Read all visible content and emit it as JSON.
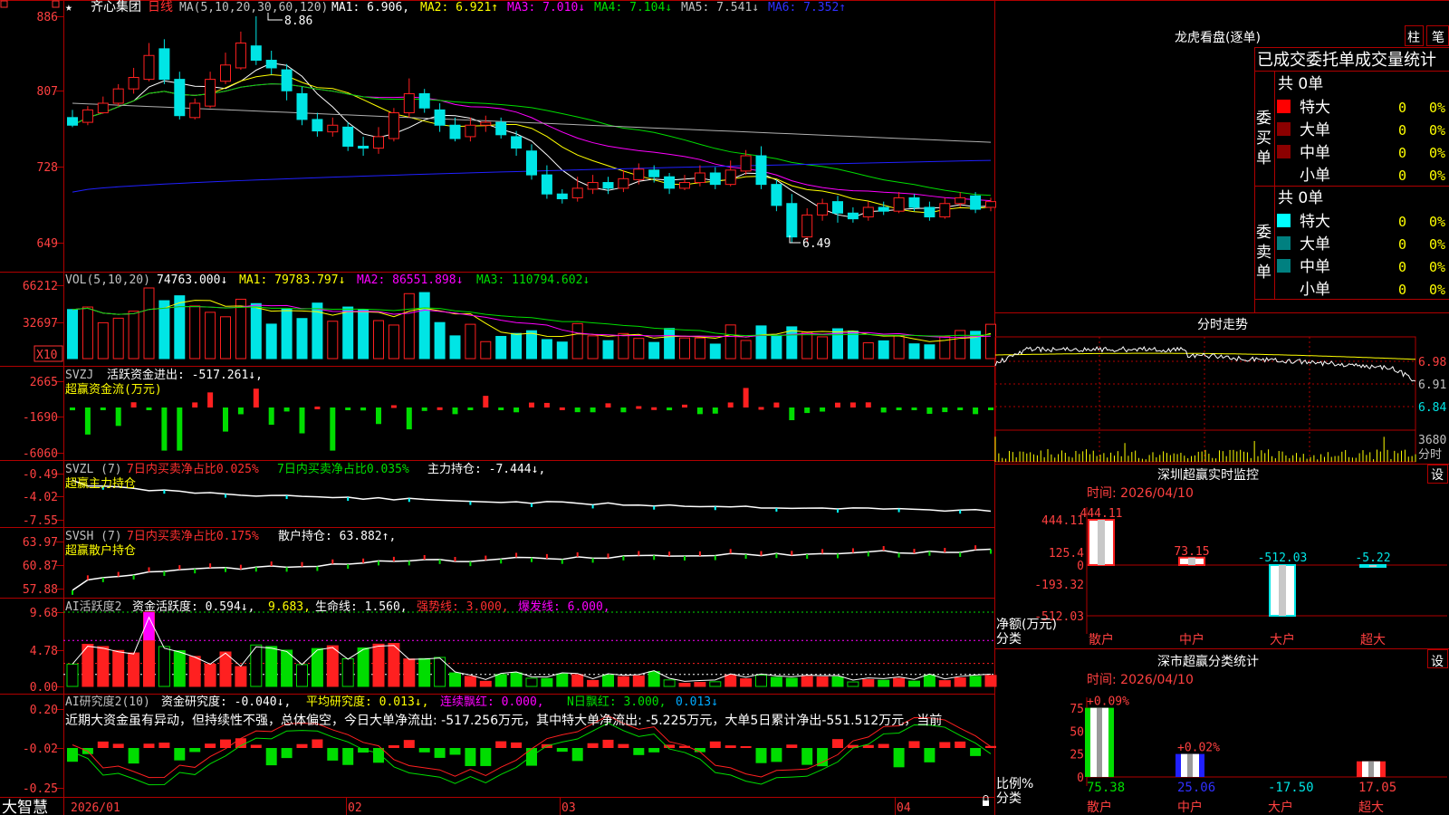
{
  "colors": {
    "up": "#ff2020",
    "down": "#00e5e5",
    "grid": "#b00000",
    "white": "#ffffff",
    "yellow": "#ffff00",
    "magenta": "#ff00ff",
    "green": "#00dd00",
    "blue": "#2020ff",
    "gray": "#b0b0b0",
    "cyan": "#00ffff",
    "darkred": "#8b0000",
    "teal": "#008080"
  },
  "header": {
    "star": "★",
    "name": "齐心集团",
    "period": "日线",
    "ma_label": "MA(5,10,20,30,60,120)",
    "ma": [
      {
        "k": "MA1: 6.906,",
        "c": "#ffffff"
      },
      {
        "k": "MA2: 6.921↑",
        "c": "#ffff00"
      },
      {
        "k": "MA3: 7.010↓",
        "c": "#ff00ff"
      },
      {
        "k": "MA4: 7.104↓",
        "c": "#00dd00"
      },
      {
        "k": "MA5: 7.541↓",
        "c": "#c0c0c0"
      },
      {
        "k": "MA6: 7.352↑",
        "c": "#3030ff"
      }
    ]
  },
  "price_axis": [
    "886",
    "807",
    "728",
    "649"
  ],
  "high_mark": "8.86",
  "low_mark": "6.49",
  "vol": {
    "title": "VOL(5,10,20)",
    "value": "74763.000↓",
    "ma1": "MA1: 79783.797↓",
    "ma2": "MA2: 86551.898↓",
    "ma3": "MA3: 110794.602↓",
    "axis": [
      "66212",
      "32697"
    ],
    "unit": "X10"
  },
  "svzj": {
    "title": "SVZJ",
    "label": "活跃资金进出: -517.261↓,",
    "sub": "超赢资金流(万元)",
    "axis": [
      "2665",
      "-1690",
      "-6060"
    ]
  },
  "svzl": {
    "title": "SVZL (7)",
    "t1": "7日内买卖净占比0.025%",
    "t2": "7日内买卖净占比0.035%",
    "t3": "主力持仓: -7.444↓,",
    "sub": "超赢主力持仓",
    "axis": [
      "-0.49",
      "-4.02",
      "-7.55"
    ]
  },
  "svsh": {
    "title": "SVSH (7)",
    "t1": "7日内买卖净占比0.175%",
    "t2": "散户持仓: 63.882↑,",
    "sub": "超赢散户持仓",
    "axis": [
      "63.97",
      "60.87",
      "57.88"
    ]
  },
  "ai": {
    "title": "AI活跃度2",
    "t1": "资金活跃度: 0.594↓,",
    "t2": "9.683,",
    "t3": "生命线: 1.560,",
    "t4": "强势线: 3.000,",
    "t5": "爆发线: 6.000,",
    "axis": [
      "9.68",
      "4.78",
      "0.00"
    ]
  },
  "air": {
    "title": "AI研究度2(10)",
    "t1": "资金研究度: -0.040↓,",
    "t2": "平均研究度: 0.013↓,",
    "t3": "连续飘红: 0.000,",
    "t4": "N日飘红: 3.000,",
    "t5": "0.013↓",
    "text": "近期大资金虽有异动，但持续性不强，总体偏空，今日大单净流出: -517.256万元，其中特大单净流出: -5.225万元，大单5日累计净出-551.512万元，当前",
    "axis": [
      "0.20",
      "-0.02",
      "-0.25"
    ]
  },
  "xaxis": {
    "logo": "大智慧",
    "labels": [
      "2026/01",
      "02",
      "03",
      "04"
    ]
  },
  "lhb": {
    "title": "龙虎看盘(逐单)",
    "btn1": "柱",
    "btn2": "笔",
    "sub": "已成交委托单成交量统计",
    "buy": {
      "label": "委买单",
      "count": "共 0单",
      "rows": [
        {
          "n": "特大",
          "v": "0",
          "p": "0%",
          "c": "#ff0000"
        },
        {
          "n": "大单",
          "v": "0",
          "p": "0%",
          "c": "#8b0000"
        },
        {
          "n": "中单",
          "v": "0",
          "p": "0%",
          "c": "#8b0000"
        },
        {
          "n": "小单",
          "v": "0",
          "p": "0%",
          "c": ""
        }
      ]
    },
    "sell": {
      "label": "委卖单",
      "count": "共 0单",
      "rows": [
        {
          "n": "特大",
          "v": "0",
          "p": "0%",
          "c": "#00ffff"
        },
        {
          "n": "大单",
          "v": "0",
          "p": "0%",
          "c": "#008080"
        },
        {
          "n": "中单",
          "v": "0",
          "p": "0%",
          "c": "#008080"
        },
        {
          "n": "小单",
          "v": "0",
          "p": "0%",
          "c": ""
        }
      ]
    }
  },
  "fenshi": {
    "title": "分时走势",
    "axis": [
      "6.98",
      "6.91",
      "6.84"
    ],
    "vol": "3680",
    "unit": "分时"
  },
  "szjk": {
    "title": "深圳超赢实时监控",
    "btn": "设",
    "time": "时间: 2026/04/10",
    "axis": [
      "444.11",
      "125.4",
      "0",
      "-193.32",
      "-512.03"
    ],
    "ylabel": "净额(万元)",
    "xlabel": "分类",
    "cats": [
      "散户",
      "中户",
      "大户",
      "超大"
    ],
    "vals": [
      "444.11",
      "73.15",
      "-512.03",
      "-5.22"
    ]
  },
  "ssfl": {
    "title": "深市超赢分类统计",
    "btn": "设",
    "time": "时间: 2026/04/10",
    "axis": [
      "75",
      "50",
      "25",
      "0"
    ],
    "ylabel": "比例%",
    "xlabel": "分类",
    "cats": [
      "散户",
      "中户",
      "大户",
      "超大"
    ],
    "tops": [
      "+0.09%",
      "+0.02%",
      "",
      ""
    ],
    "vals": [
      "75.38",
      "25.06",
      "-17.50",
      "17.05"
    ]
  },
  "chart_data": [
    {
      "type": "candlestick",
      "title": "齐心集团 日线",
      "y_axis_ticks": [
        8.86,
        8.07,
        7.28,
        6.49
      ],
      "high": 8.86,
      "low": 6.49,
      "ma_last": {
        "MA5": 6.906,
        "MA10": 6.921,
        "MA20": 7.01,
        "MA30": 7.104,
        "MA60": 7.541,
        "MA120": 7.352
      },
      "candles": [
        [
          7.8,
          7.72,
          7.88,
          7.7
        ],
        [
          7.75,
          7.88,
          7.92,
          7.72
        ],
        [
          7.85,
          7.95,
          8.02,
          7.84
        ],
        [
          7.95,
          8.1,
          8.15,
          7.92
        ],
        [
          8.1,
          8.22,
          8.32,
          8.05
        ],
        [
          8.2,
          8.45,
          8.58,
          8.18
        ],
        [
          8.52,
          8.2,
          8.62,
          8.15
        ],
        [
          8.2,
          7.82,
          8.28,
          7.78
        ],
        [
          7.8,
          7.95,
          8.0,
          7.78
        ],
        [
          7.92,
          8.2,
          8.28,
          7.9
        ],
        [
          8.18,
          8.35,
          8.48,
          8.15
        ],
        [
          8.32,
          8.58,
          8.7,
          8.3
        ],
        [
          8.55,
          8.4,
          8.86,
          8.35
        ],
        [
          8.4,
          8.32,
          8.5,
          8.25
        ],
        [
          8.3,
          8.08,
          8.36,
          7.98
        ],
        [
          8.05,
          7.78,
          8.12,
          7.72
        ],
        [
          7.78,
          7.66,
          7.85,
          7.6
        ],
        [
          7.65,
          7.72,
          7.8,
          7.6
        ],
        [
          7.7,
          7.5,
          7.75,
          7.45
        ],
        [
          7.5,
          7.48,
          7.6,
          7.4
        ],
        [
          7.48,
          7.6,
          7.7,
          7.42
        ],
        [
          7.58,
          7.85,
          7.9,
          7.55
        ],
        [
          7.85,
          8.05,
          8.21,
          7.8
        ],
        [
          8.05,
          7.9,
          8.1,
          7.85
        ],
        [
          7.88,
          7.72,
          7.95,
          7.65
        ],
        [
          7.72,
          7.58,
          7.8,
          7.55
        ],
        [
          7.6,
          7.72,
          7.8,
          7.55
        ],
        [
          7.72,
          7.75,
          7.82,
          7.65
        ],
        [
          7.75,
          7.62,
          7.8,
          7.58
        ],
        [
          7.6,
          7.48,
          7.66,
          7.4
        ],
        [
          7.45,
          7.2,
          7.52,
          7.15
        ],
        [
          7.2,
          7.0,
          7.3,
          6.95
        ],
        [
          7.0,
          6.95,
          7.05,
          6.9
        ],
        [
          6.96,
          7.06,
          7.18,
          6.92
        ],
        [
          7.05,
          7.12,
          7.2,
          7.0
        ],
        [
          7.12,
          7.06,
          7.18,
          7.0
        ],
        [
          7.06,
          7.16,
          7.25,
          7.02
        ],
        [
          7.15,
          7.26,
          7.32,
          7.1
        ],
        [
          7.25,
          7.18,
          7.3,
          7.12
        ],
        [
          7.18,
          7.06,
          7.22,
          7.0
        ],
        [
          7.06,
          7.12,
          7.2,
          7.04
        ],
        [
          7.12,
          7.22,
          7.3,
          7.08
        ],
        [
          7.22,
          7.1,
          7.28,
          7.05
        ],
        [
          7.1,
          7.25,
          7.35,
          7.08
        ],
        [
          7.24,
          7.4,
          7.46,
          7.2
        ],
        [
          7.4,
          7.1,
          7.5,
          7.05
        ],
        [
          7.1,
          6.88,
          7.15,
          6.82
        ],
        [
          6.9,
          6.55,
          7.0,
          6.49
        ],
        [
          6.55,
          6.78,
          6.85,
          6.5
        ],
        [
          6.78,
          6.9,
          6.95,
          6.72
        ],
        [
          6.92,
          6.8,
          6.98,
          6.7
        ],
        [
          6.8,
          6.74,
          6.86,
          6.7
        ],
        [
          6.76,
          6.86,
          6.92,
          6.72
        ],
        [
          6.86,
          6.82,
          6.92,
          6.78
        ],
        [
          6.82,
          6.96,
          7.02,
          6.8
        ],
        [
          6.96,
          6.86,
          7.0,
          6.82
        ],
        [
          6.86,
          6.76,
          6.92,
          6.72
        ],
        [
          6.76,
          6.9,
          6.96,
          6.74
        ],
        [
          6.9,
          6.96,
          7.02,
          6.86
        ],
        [
          6.98,
          6.84,
          7.02,
          6.8
        ],
        [
          6.86,
          6.92,
          6.96,
          6.82
        ]
      ]
    },
    {
      "type": "bar",
      "title": "VOL(5,10,20)",
      "y_axis_ticks": [
        66212,
        32697
      ],
      "unit": "X10",
      "latest": 74763.0,
      "MA1": 79783.797,
      "MA2": 86551.898,
      "MA3": 110794.602
    },
    {
      "type": "bar",
      "title": "SVZJ 活跃资金进出",
      "latest": -517.261,
      "y_axis_ticks": [
        2665,
        -1690,
        -6060
      ]
    },
    {
      "type": "line",
      "title": "SVZL 主力持仓",
      "latest": -7.444,
      "y_axis_ticks": [
        -0.49,
        -4.02,
        -7.55
      ]
    },
    {
      "type": "line",
      "title": "SVSH 散户持仓",
      "latest": 63.882,
      "y_axis_ticks": [
        63.97,
        60.87,
        57.88
      ]
    },
    {
      "type": "bar",
      "title": "AI活跃度2",
      "资金活跃度": 0.594,
      "peak": 9.683,
      "生命线": 1.56,
      "强势线": 3.0,
      "爆发线": 6.0,
      "y_axis_ticks": [
        9.68,
        4.78,
        0.0
      ]
    },
    {
      "type": "bar",
      "title": "AI研究度2(10)",
      "资金研究度": -0.04,
      "平均研究度": 0.013,
      "连续飘红": 0.0,
      "N日飘红": 3.0,
      "y_axis_ticks": [
        0.2,
        -0.02,
        -0.25
      ]
    },
    {
      "type": "bar",
      "title": "深圳超赢实时监控",
      "categories": [
        "散户",
        "中户",
        "大户",
        "超大"
      ],
      "values": [
        444.11,
        73.15,
        -512.03,
        -5.22
      ],
      "ylabel": "净额(万元)",
      "xlabel": "分类",
      "y_axis_ticks": [
        444.11,
        125.4,
        0,
        -193.32,
        -512.03
      ]
    },
    {
      "type": "bar",
      "title": "深市超赢分类统计",
      "categories": [
        "散户",
        "中户",
        "大户",
        "超大"
      ],
      "values": [
        75.38,
        25.06,
        -17.5,
        17.05
      ],
      "ylabel": "比例%",
      "xlabel": "分类",
      "y_axis_ticks": [
        75,
        50,
        25,
        0
      ]
    }
  ]
}
